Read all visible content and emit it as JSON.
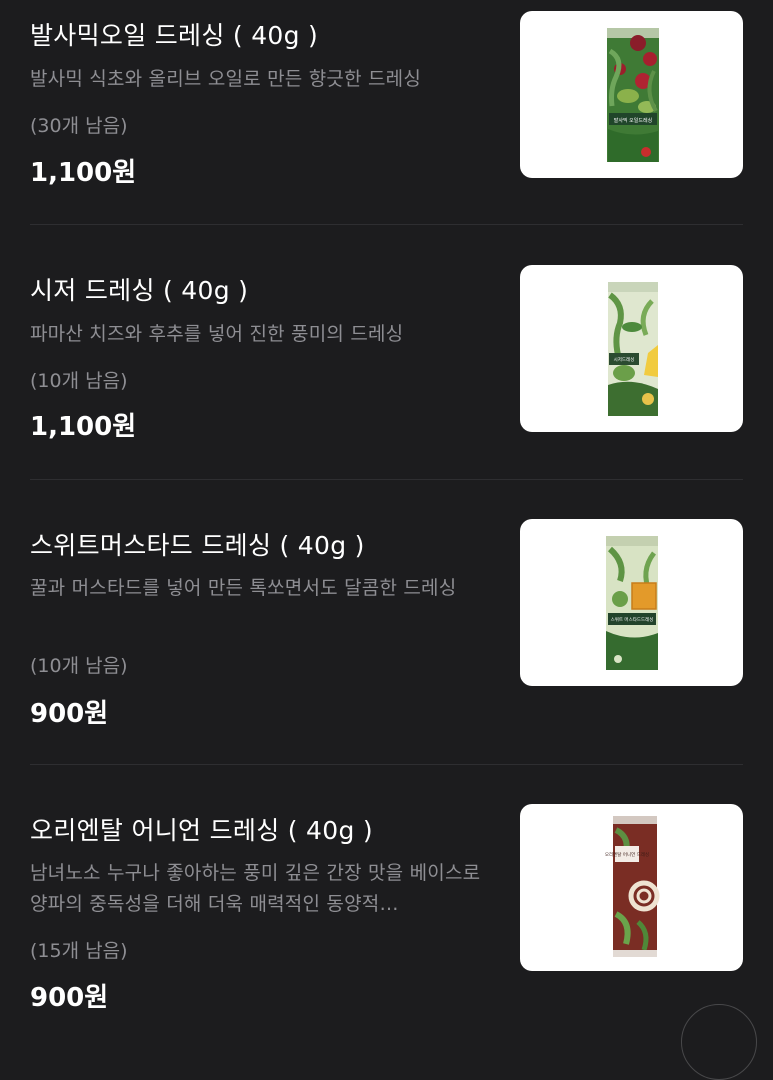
{
  "items": [
    {
      "name": "발사믹오일 드레싱 ( 40g )",
      "description": "발사믹 식초와 올리브 오일로 만든 향긋한 드레싱",
      "stock": "(30개 남음)",
      "price": "1,100원",
      "package_label": "발사믹 오일드레싱"
    },
    {
      "name": "시저 드레싱 ( 40g )",
      "description": "파마산 치즈와 후추를 넣어 진한 풍미의 드레싱",
      "stock": "(10개 남음)",
      "price": "1,100원",
      "package_label": "시저드레싱"
    },
    {
      "name": "스위트머스타드 드레싱 ( 40g )",
      "description": "꿀과 머스타드를 넣어 만든 톡쏘면서도 달콤한 드레싱",
      "stock": "(10개 남음)",
      "price": "900원",
      "package_label": "스위트 머스타드드레싱"
    },
    {
      "name": "오리엔탈 어니언 드레싱 ( 40g )",
      "description": "남녀노소 누구나 좋아하는 풍미 깊은 간장 맛을 베이스로 양파의 중독성을 더해 더욱 매력적인 동양적…",
      "stock": "(15개 남음)",
      "price": "900원",
      "package_label": "오리엔탈 어니언 드레싱"
    }
  ]
}
